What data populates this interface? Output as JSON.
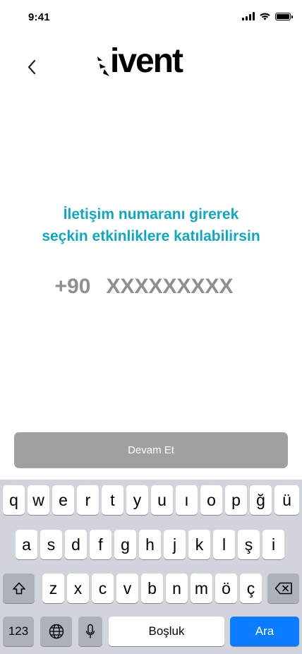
{
  "status_bar": {
    "time": "9:41"
  },
  "header": {
    "brand": "ivent"
  },
  "main": {
    "headline_line1": "İletişim numaranı girerek",
    "headline_line2": "seçkin etkinliklere katılabilirsin",
    "country_code": "+90",
    "phone_placeholder": "XXXXXXXXX",
    "phone_value": ""
  },
  "actions": {
    "continue_label": "Devam Et"
  },
  "keyboard": {
    "row1": [
      "q",
      "w",
      "e",
      "r",
      "t",
      "y",
      "u",
      "ı",
      "o",
      "p",
      "ğ",
      "ü"
    ],
    "row2": [
      "a",
      "s",
      "d",
      "f",
      "g",
      "h",
      "j",
      "k",
      "l",
      "ş",
      "i"
    ],
    "row3": [
      "z",
      "x",
      "c",
      "v",
      "b",
      "n",
      "m",
      "ö",
      "ç"
    ],
    "numbers_label": "123",
    "space_label": "Boşluk",
    "return_label": "Ara"
  },
  "colors": {
    "accent": "#14a6be",
    "button_disabled": "#a0a0a0",
    "keyboard_bg": "#d1d4da",
    "return_key": "#0b7cff"
  }
}
